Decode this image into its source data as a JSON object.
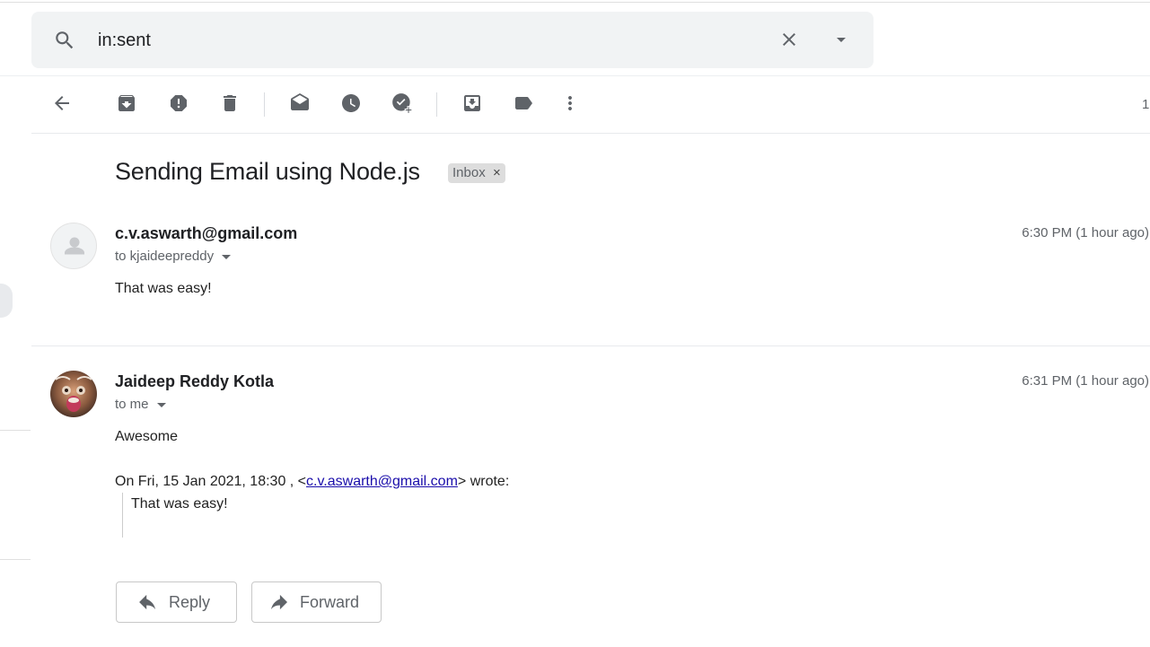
{
  "search": {
    "query": "in:sent"
  },
  "toolbar": {
    "icons": [
      "back-icon",
      "archive-icon",
      "report-spam-icon",
      "delete-icon",
      "mark-unread-icon",
      "snooze-icon",
      "add-task-icon",
      "move-to-icon",
      "label-icon",
      "more-icon"
    ],
    "page_count": "1"
  },
  "thread": {
    "subject": "Sending Email using Node.js",
    "label": "Inbox",
    "label_close": "×"
  },
  "messages": [
    {
      "sender": "c.v.aswarth@gmail.com",
      "recipient": "to kjaideepreddy",
      "time": "6:30 PM (1 hour ago)",
      "body": "That was easy!"
    },
    {
      "sender": "Jaideep Reddy Kotla",
      "recipient": "to me",
      "time": "6:31 PM (1 hour ago)",
      "body": "Awesome",
      "quote_prefix": "On Fri, 15 Jan 2021, 18:30 , <",
      "quote_email": "c.v.aswarth@gmail.com",
      "quote_suffix": "> wrote:",
      "quote_text": "That was easy!"
    }
  ],
  "actions": {
    "reply": "Reply",
    "forward": "Forward"
  },
  "colors": {
    "icon": "#5f6368",
    "link": "#1a0dab",
    "search_bg": "#f1f3f4"
  }
}
